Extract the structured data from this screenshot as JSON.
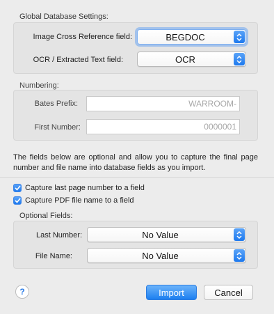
{
  "global": {
    "title": "Global Database Settings:",
    "image_xref_label": "Image Cross Reference field:",
    "image_xref_value": "BEGDOC",
    "ocr_label": "OCR / Extracted Text field:",
    "ocr_value": "OCR"
  },
  "numbering": {
    "title": "Numbering:",
    "bates_label": "Bates Prefix:",
    "bates_placeholder": "WARROOM-",
    "first_label": "First Number:",
    "first_placeholder": "0000001"
  },
  "description": "The fields below are optional and allow you to capture the final page number and file name into database fields as you import.",
  "options": {
    "capture_last_page_label": "Capture last page number to a field",
    "capture_last_page_checked": true,
    "capture_pdf_name_label": "Capture PDF file name to a field",
    "capture_pdf_name_checked": true
  },
  "optional_fields": {
    "title": "Optional Fields:",
    "last_number_label": "Last Number:",
    "last_number_value": "No Value",
    "file_name_label": "File Name:",
    "file_name_value": "No Value"
  },
  "footer": {
    "help_symbol": "?",
    "import_label": "Import",
    "cancel_label": "Cancel"
  },
  "colors": {
    "accent": "#1d79ee",
    "window_bg": "#ececec"
  }
}
